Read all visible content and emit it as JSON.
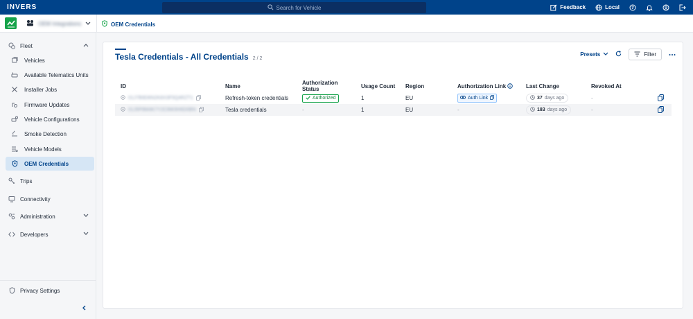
{
  "app": {
    "logo": "INVERS"
  },
  "search": {
    "placeholder": "Search for Vehicle"
  },
  "topbar": {
    "feedback": "Feedback",
    "locale": "Local"
  },
  "org": {
    "name": "OEM Integrations"
  },
  "breadcrumb": {
    "current": "OEM Credentials"
  },
  "sidebar": {
    "fleet": "Fleet",
    "items": [
      {
        "label": "Vehicles",
        "icon": "vehicles-icon"
      },
      {
        "label": "Available Telematics Units",
        "icon": "telematics-icon"
      },
      {
        "label": "Installer Jobs",
        "icon": "tools-icon"
      },
      {
        "label": "Firmware Updates",
        "icon": "firmware-icon"
      },
      {
        "label": "Vehicle Configurations",
        "icon": "config-icon"
      },
      {
        "label": "Smoke Detection",
        "icon": "smoke-icon"
      },
      {
        "label": "Vehicle Models",
        "icon": "models-icon"
      },
      {
        "label": "OEM Credentials",
        "icon": "credentials-icon",
        "active": true
      }
    ],
    "trips": "Trips",
    "connectivity": "Connectivity",
    "administration": "Administration",
    "developers": "Developers",
    "privacy": "Privacy Settings"
  },
  "page": {
    "title": "Tesla Credentials - All Credentials",
    "count": "2 / 2",
    "presets_label": "Presets",
    "filter_label": "Filter"
  },
  "table": {
    "headers": {
      "id": "ID",
      "name": "Name",
      "auth_status": "Authorization Status",
      "usage": "Usage Count",
      "region": "Region",
      "auth_link": "Authorization Link",
      "last_change": "Last Change",
      "revoked_at": "Revoked At"
    },
    "rows": [
      {
        "id": "01J7B9D6N2K8X3F5Q4RZT1",
        "name": "Refresh-token credentials",
        "auth_status": "Authorized",
        "usage": "1",
        "region": "EU",
        "auth_link": "Auth Link",
        "last_change_num": "37",
        "last_change_unit": "days ago",
        "revoked_at": "-"
      },
      {
        "id": "01J5P8M4K7Y2C9W3H6D0BN",
        "name": "Tesla credentials",
        "auth_status": "-",
        "usage": "1",
        "region": "EU",
        "auth_link": "-",
        "last_change_num": "183",
        "last_change_unit": "days ago",
        "revoked_at": "-"
      }
    ]
  },
  "colors": {
    "brand": "#00438a",
    "success": "#16a34a",
    "active_bg": "#d6e6f5"
  }
}
